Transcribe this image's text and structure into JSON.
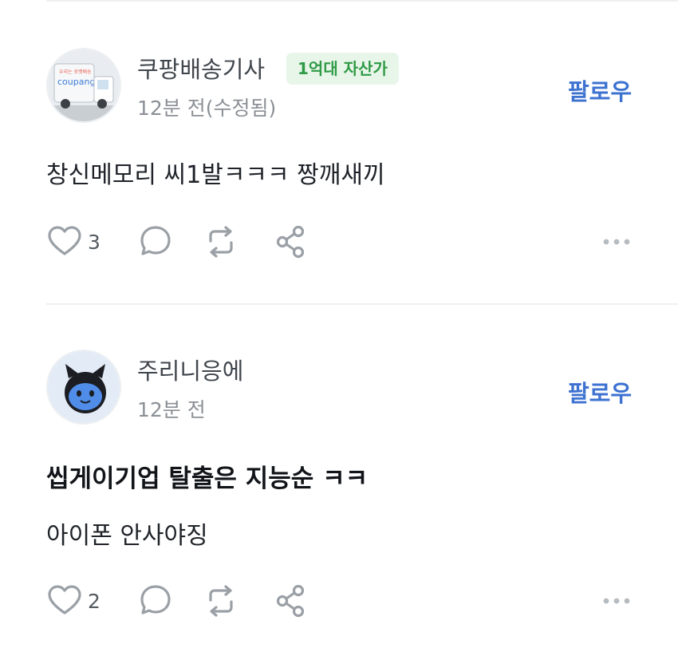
{
  "posts": [
    {
      "author": "쿠팡배송기사",
      "badge": "1억대 자산가",
      "time": "12분 전(수정됨)",
      "follow_label": "팔로우",
      "avatar_text": "coupang",
      "body": "창신메모리 씨1발ㅋㅋㅋ 짱깨새끼",
      "like_count": "3",
      "icons": [
        "heart-icon",
        "comment-icon",
        "repost-icon",
        "share-icon",
        "more-icon"
      ]
    },
    {
      "author": "주리니응에",
      "time": "12분 전",
      "follow_label": "팔로우",
      "title": "씹게이기업 탈출은 지능순 ㅋㅋ",
      "body": "아이폰 안사야징",
      "like_count": "2",
      "icons": [
        "heart-icon",
        "comment-icon",
        "repost-icon",
        "share-icon",
        "more-icon"
      ]
    }
  ],
  "colors": {
    "accent": "#3d72d1",
    "badge_bg": "#e8f6ea",
    "badge_text": "#2f9a45",
    "icon": "#9aa0a6",
    "divider": "#eef0f2"
  }
}
